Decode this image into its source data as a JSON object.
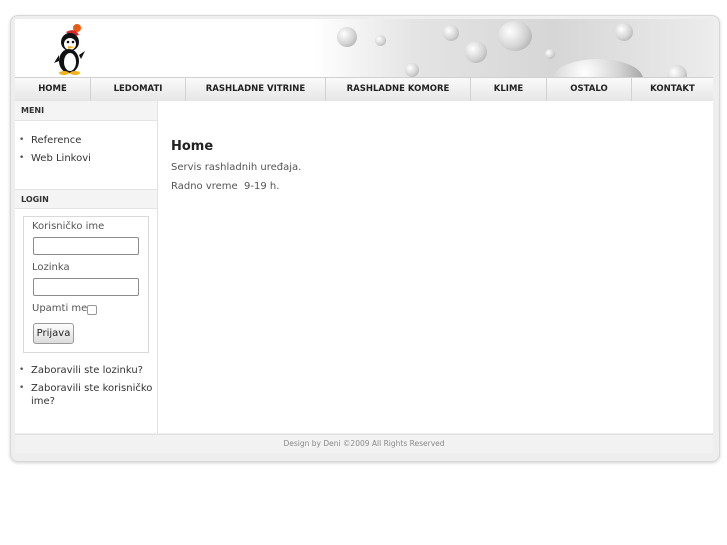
{
  "header": {
    "logo_icon": "penguin-logo-icon"
  },
  "nav": {
    "items": [
      {
        "label": "HOME"
      },
      {
        "label": "LEDOMATI"
      },
      {
        "label": "RASHLADNE VITRINE"
      },
      {
        "label": "RASHLADNE KOMORE"
      },
      {
        "label": "KLIME"
      },
      {
        "label": "OSTALO"
      },
      {
        "label": "KONTAKT"
      }
    ]
  },
  "sidebar": {
    "menu_title": "MENI",
    "menu_items": [
      {
        "label": "Reference"
      },
      {
        "label": "Web Linkovi"
      }
    ],
    "login_title": "LOGIN",
    "login": {
      "username_label": "Korisničko ime",
      "username_value": "",
      "password_label": "Lozinka",
      "password_value": "",
      "remember_label": "Upamti me",
      "remember_checked": false,
      "submit_label": "Prijava"
    },
    "links": [
      {
        "label": "Zaboravili ste lozinku?"
      },
      {
        "label": "Zaboravili ste korisničko ime?"
      }
    ]
  },
  "main": {
    "title": "Home",
    "paragraphs": [
      "Servis rashladnih uređaja.",
      "Radno vreme  9-19 h."
    ]
  },
  "footer": {
    "text": "Design by Deni ©2009 All Rights Reserved"
  }
}
